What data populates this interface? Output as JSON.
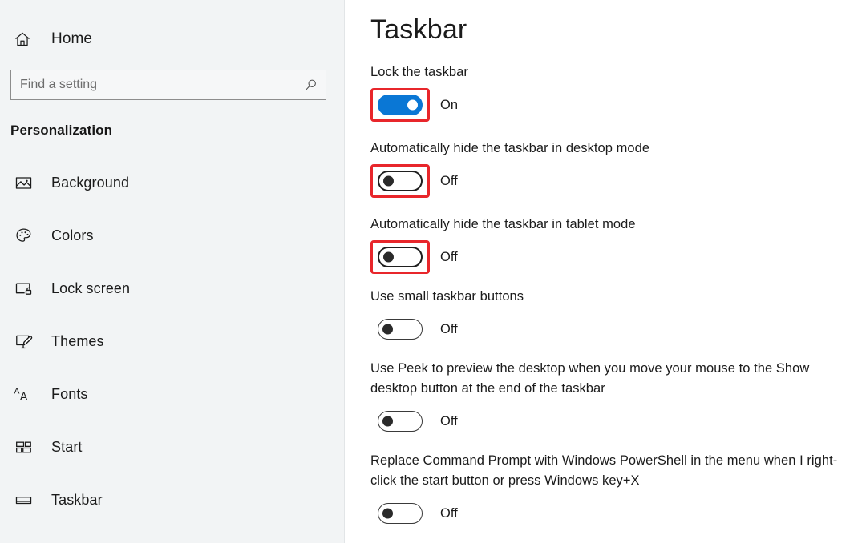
{
  "sidebar": {
    "home": {
      "label": "Home",
      "icon": "home-icon"
    },
    "search": {
      "placeholder": "Find a setting",
      "value": "",
      "icon": "search-icon"
    },
    "category": "Personalization",
    "items": [
      {
        "label": "Background",
        "icon": "image-icon"
      },
      {
        "label": "Colors",
        "icon": "palette-icon"
      },
      {
        "label": "Lock screen",
        "icon": "lock-screen-icon"
      },
      {
        "label": "Themes",
        "icon": "themes-brush-icon"
      },
      {
        "label": "Fonts",
        "icon": "fonts-aa-icon"
      },
      {
        "label": "Start",
        "icon": "start-tiles-icon"
      },
      {
        "label": "Taskbar",
        "icon": "taskbar-icon"
      }
    ]
  },
  "main": {
    "title": "Taskbar",
    "settings": [
      {
        "label": "Lock the taskbar",
        "state": "On",
        "on": true,
        "highlighted": true
      },
      {
        "label": "Automatically hide the taskbar in desktop mode",
        "state": "Off",
        "on": false,
        "highlighted": true
      },
      {
        "label": "Automatically hide the taskbar in tablet mode",
        "state": "Off",
        "on": false,
        "highlighted": true
      },
      {
        "label": "Use small taskbar buttons",
        "state": "Off",
        "on": false,
        "highlighted": false
      },
      {
        "label": "Use Peek to preview the desktop when you move your mouse to the Show desktop button at the end of the taskbar",
        "state": "Off",
        "on": false,
        "highlighted": false
      },
      {
        "label": "Replace Command Prompt with Windows PowerShell in the menu when I right-click the start button or press Windows key+X",
        "state": "Off",
        "on": false,
        "highlighted": false
      }
    ]
  },
  "colors": {
    "accent": "#0a77d5",
    "highlight": "#e8262b",
    "sidebar_bg": "#f2f4f5",
    "main_bg": "#ffffff",
    "text": "#1b1b1b"
  }
}
